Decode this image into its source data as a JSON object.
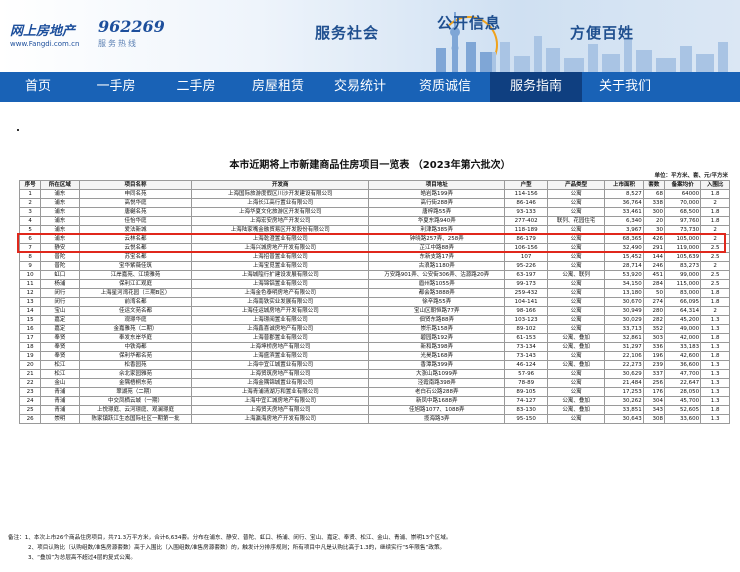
{
  "header": {
    "logo_text": "网上房地产",
    "logo_url": "www.Fangdi.com.cn",
    "hotline_number": "962269",
    "hotline_label": "服务热线",
    "slogans": [
      "服务社会",
      "公开信息",
      "方便百姓"
    ]
  },
  "nav": {
    "items": [
      {
        "label": "首页"
      },
      {
        "label": "一手房"
      },
      {
        "label": "二手房"
      },
      {
        "label": "房屋租赁"
      },
      {
        "label": "交易统计"
      },
      {
        "label": "资质诚信"
      },
      {
        "label": "服务指南"
      },
      {
        "label": "关于我们"
      }
    ],
    "active_index": 6,
    "colors": {
      "bar": "#1962b6",
      "active": "#0f3f80"
    }
  },
  "document": {
    "title": "本市近期将上市新建商品住房项目一览表 （2023年第六批次）",
    "unit_note": "单位：平方米、套、元/平方米",
    "columns": [
      "序号",
      "所在区域",
      "项目名称",
      "开发商",
      "项目地址",
      "户型",
      "产品类型",
      "上市面积",
      "套数",
      "备案均价",
      "入围比"
    ],
    "rows": [
      [
        "1",
        "浦东",
        "申同名苑",
        "上海国际旅游度假区川沙开发建设有限公司",
        "皓岩路199弄",
        "114-156",
        "公寓",
        "8,527",
        "68",
        "64000",
        "1.8"
      ],
      [
        "2",
        "浦东",
        "高悦华庭",
        "上海长江高行置业有限公司",
        "高行街288弄",
        "86-146",
        "公寓",
        "36,764",
        "338",
        "70,000",
        "2"
      ],
      [
        "3",
        "浦东",
        "唐樾名苑",
        "上海华夏文化旅游区开发有限公司",
        "唐梓路55弄",
        "93-133",
        "公寓",
        "33,461",
        "300",
        "68,500",
        "1.8"
      ],
      [
        "4",
        "浦东",
        "佳怡华庭",
        "上海宏安房地产开发公司",
        "华夏东路940弄",
        "277-402",
        "联列、花园住宅",
        "6,340",
        "20",
        "97,760",
        "1.8"
      ],
      [
        "5",
        "浦东",
        "爱法新城",
        "上海陆家嘴金融贸易区开发股份有限公司",
        "利津路385弄",
        "118-189",
        "公寓",
        "3,967",
        "30",
        "73,730",
        "2"
      ],
      [
        "6",
        "浦东",
        "云林名都",
        "上海乾澄置业有限公司",
        "钟晓路257弄、258弄",
        "86-179",
        "公寓",
        "68,365",
        "426",
        "105,000",
        "2"
      ],
      [
        "7",
        "静安",
        "云悦名都",
        "上海兴城房地产开发有限公司",
        "芷江中路88弄",
        "106-156",
        "公寓",
        "32,490",
        "291",
        "119,000",
        "2.5"
      ],
      [
        "8",
        "普陀",
        "苏宝名都",
        "上海招普置业有限公司",
        "东新支路17弄",
        "107",
        "公寓",
        "15,452",
        "144",
        "105,639",
        "2.5"
      ],
      [
        "9",
        "普陀",
        "宝华紫薇佳筑",
        "上海宝觅置业有限公司",
        "古浪路1180弄",
        "95-226",
        "公寓",
        "28,714",
        "246",
        "83,273",
        "2"
      ],
      [
        "10",
        "虹口",
        "江岸嘉苑、江境雅苑",
        "上海城隍行扩建设发展有限公司",
        "万安路901弄、公安街306弄、沽源路20弄",
        "63-197",
        "公寓、联列",
        "53,920",
        "451",
        "99,000",
        "2.5"
      ],
      [
        "11",
        "杨浦",
        "保利江汇观庭",
        "上海锦铝置业有限公司",
        "眉州路1055弄",
        "99-173",
        "公寓",
        "34,150",
        "284",
        "115,000",
        "2.5"
      ],
      [
        "12",
        "闵行",
        "上海星河湾花园（三期B区）",
        "上海金色泰明房地产有限公司",
        "都会路3888弄",
        "259-432",
        "公寓",
        "13,180",
        "50",
        "83,000",
        "1.8"
      ],
      [
        "13",
        "闵行",
        "前湾名都",
        "上海南铁实业发展有限公司",
        "徐辛路55弄",
        "104-141",
        "公寓",
        "30,670",
        "274",
        "66,095",
        "1.8"
      ],
      [
        "14",
        "宝山",
        "佳运文苑名都",
        "上海佳运城房地产开发有限公司",
        "宝山区朝恒路77弄",
        "98-166",
        "公寓",
        "30,949",
        "280",
        "64,314",
        "2"
      ],
      [
        "15",
        "嘉定",
        "观璟华庭",
        "上海璟阅置业有限公司",
        "佃贤东路88弄",
        "103-123",
        "公寓",
        "30,029",
        "282",
        "45,200",
        "1.3"
      ],
      [
        "16",
        "嘉定",
        "金嘉雅苑（二期）",
        "上海鑫喜诚房地产有限公司",
        "崇乐路158弄",
        "89-102",
        "公寓",
        "33,713",
        "352",
        "49,000",
        "1.3"
      ],
      [
        "17",
        "奉贤",
        "奉发东岸华庭",
        "上海普郡置业有限公司",
        "碧园路192弄",
        "61-153",
        "公寓、叠加",
        "32,861",
        "303",
        "42,000",
        "1.8"
      ],
      [
        "18",
        "奉贤",
        "中铁海都",
        "上海坤桥房地产有限公司",
        "新和路398弄",
        "73-134",
        "公寓、叠加",
        "31,297",
        "336",
        "33,183",
        "1.3"
      ],
      [
        "19",
        "奉贤",
        "保利华都名苑",
        "上海盛滨置业有限公司",
        "光昊路168弄",
        "73-143",
        "公寓",
        "22,106",
        "196",
        "42,600",
        "1.8"
      ],
      [
        "20",
        "松江",
        "松香园苑",
        "上海中宜江城置业有限公司",
        "香潭路399弄",
        "46-124",
        "公寓、叠加",
        "22,273",
        "239",
        "36,600",
        "1.3"
      ],
      [
        "21",
        "松江",
        "佘北家园雅苑",
        "上海贸筑房地产有限公司",
        "大涨山路1099弄",
        "57-96",
        "公寓",
        "30,629",
        "337",
        "47,700",
        "1.3"
      ],
      [
        "22",
        "金山",
        "金隅梧桐东苑",
        "上海金隅锦城置业有限公司",
        "泾霞南路398弄",
        "78-89",
        "公寓",
        "21,484",
        "256",
        "22,647",
        "1.3"
      ],
      [
        "23",
        "青浦",
        "翠湖苑（二期）",
        "上海青浦清湖万和置业有限公司",
        "老白石公路288弄",
        "89-105",
        "公寓",
        "17,253",
        "176",
        "28,050",
        "1.3"
      ],
      [
        "24",
        "青浦",
        "中交凤栖云城（一期）",
        "上海中宜汇城房地产有限公司",
        "新凤中路1688弄",
        "74-127",
        "公寓、叠加",
        "30,262",
        "304",
        "45,700",
        "1.3"
      ],
      [
        "25",
        "青浦",
        "上悦璟庭、云河璟庭、观澜璟庭",
        "上海贸天房地产有限公司",
        "佳旭路1077、1088弄",
        "83-130",
        "公寓、叠加",
        "33,851",
        "343",
        "52,605",
        "1.8"
      ],
      [
        "26",
        "崇明",
        "陈家镇跃江生态国际社区一期第一批",
        "上海瀛海房地产开发有限公司",
        "揽海路3弄",
        "95-150",
        "公寓",
        "30,643",
        "308",
        "33,600",
        "1.3"
      ]
    ],
    "highlight_color": "#e0281c",
    "highlighted_rows": [
      4,
      5
    ],
    "notes": [
      "备注：1、本次上市26个商品住房项目，共71.3万平方米，合计6,634套。分布在浦东、静安、普陀、虹口、杨浦、闵行、宝山、嘉定、奉贤、松江、金山、青浦、崇明13个区域。",
      "2、项目认购比（认购组数/准售房源套数）高于入围比（入围组数/准售房源套数）的，触发计分排序规则；所有项目中凡是认购比高于1.3的，继续实行“5年限售”政策。",
      "3、“叠加”为总层高不超过4层的复式公寓。"
    ]
  }
}
